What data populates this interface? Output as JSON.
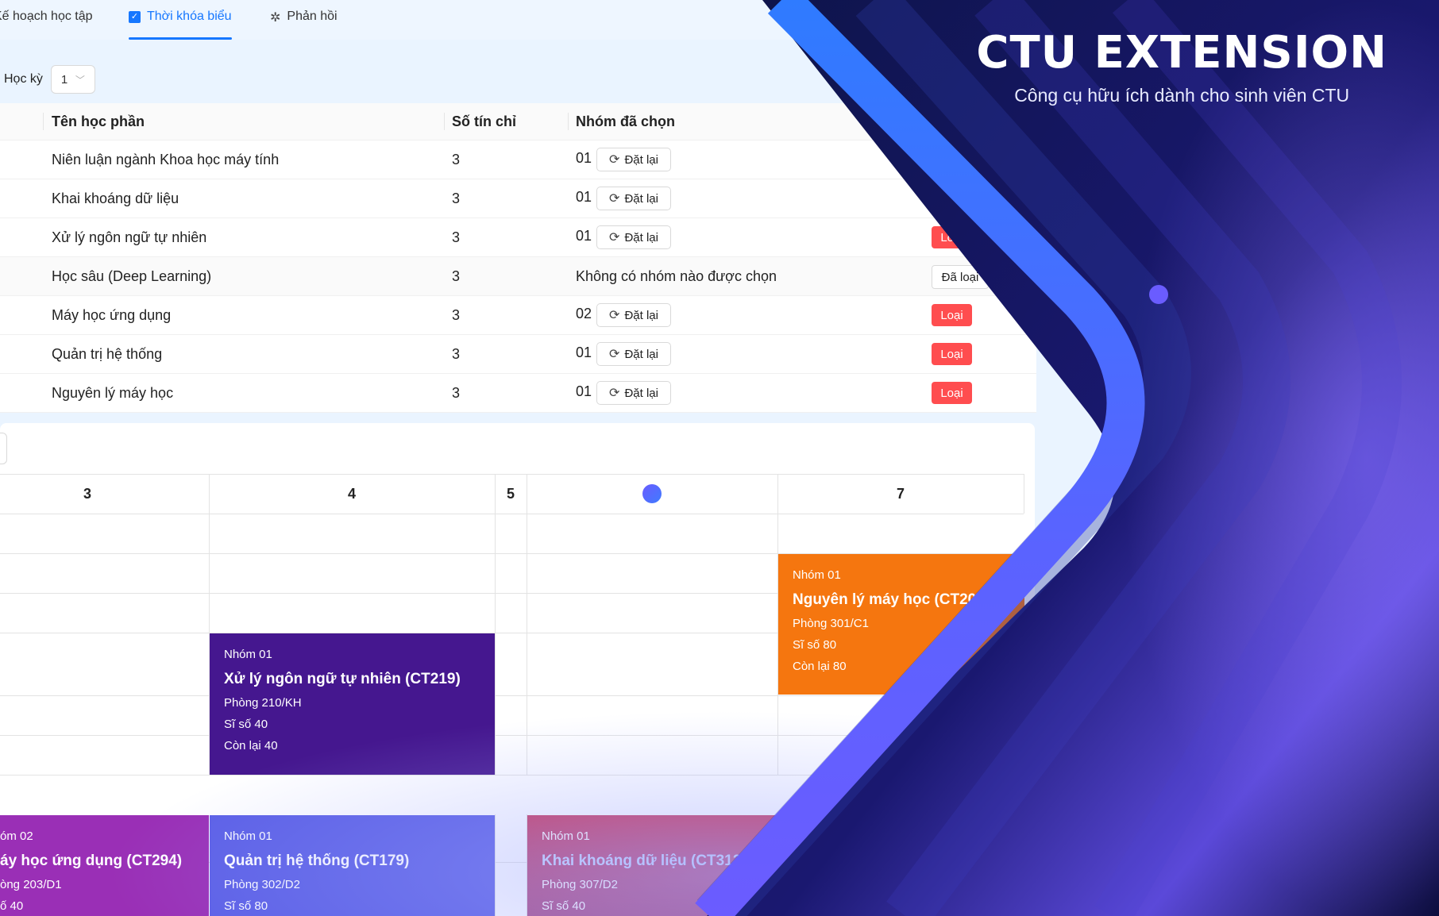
{
  "tabs": [
    {
      "label": "Kế hoạch học tập"
    },
    {
      "label": "Thời khóa biểu",
      "active": true
    },
    {
      "label": "Phản hồi"
    }
  ],
  "semester": {
    "label": "Học kỳ",
    "value": "1"
  },
  "table": {
    "headers": {
      "name": "Tên học phần",
      "credits": "Số tín chỉ",
      "group": "Nhóm đã chọn"
    },
    "reset_label": "Đặt lại",
    "remove_label": "Loại",
    "removed_label": "Đã loại",
    "rows": [
      {
        "name": "Niên luận ngành Khoa học máy tính",
        "credits": "3",
        "group": "01"
      },
      {
        "name": "Khai khoáng dữ liệu",
        "credits": "3",
        "group": "01"
      },
      {
        "name": "Xử lý ngôn ngữ tự nhiên",
        "credits": "3",
        "group": "01"
      },
      {
        "name": "Học sâu (Deep Learning)",
        "credits": "3",
        "group": "Không có nhóm nào được chọn"
      },
      {
        "name": "Máy học ứng dụng",
        "credits": "3",
        "group": "02"
      },
      {
        "name": "Quản trị hệ thống",
        "credits": "3",
        "group": "01"
      },
      {
        "name": "Nguyên lý máy học",
        "credits": "3",
        "group": "01"
      }
    ]
  },
  "schedule": {
    "days": [
      "3",
      "4",
      "5",
      "",
      "7"
    ],
    "events": [
      {
        "group": "Nhóm 01",
        "title": "Nguyên lý máy học (CT202)",
        "room": "Phòng 301/C1",
        "size": "Sĩ số 80",
        "remaining": "Còn lại 80",
        "color": "#f5760f"
      },
      {
        "group": "Nhóm 01",
        "title": "Xử lý ngôn ngữ tự nhiên (CT219)",
        "room": "Phòng 210/KH",
        "size": "Sĩ số 40",
        "remaining": "Còn lại 40",
        "color": "#45178f"
      },
      {
        "group": "óm 02",
        "title": "áy học ứng dụng (CT294)",
        "room": "òng 203/D1",
        "size": "ố 40",
        "color": "#9a2fb6"
      },
      {
        "group": "Nhóm 01",
        "title": "Quản trị hệ thống (CT179)",
        "room": "Phòng 302/D2",
        "size": "Sĩ số 80",
        "color": "#5b5fe6"
      },
      {
        "group": "Nhóm 01",
        "title": "Khai khoáng dữ liệu (CT312)",
        "room": "Phòng 307/D2",
        "size": "Sĩ số 40",
        "color": "#c8385f"
      }
    ]
  },
  "banner": {
    "title": "CTU EXTENSION",
    "subtitle": "Công cụ hữu ích dành cho sinh viên CTU"
  }
}
